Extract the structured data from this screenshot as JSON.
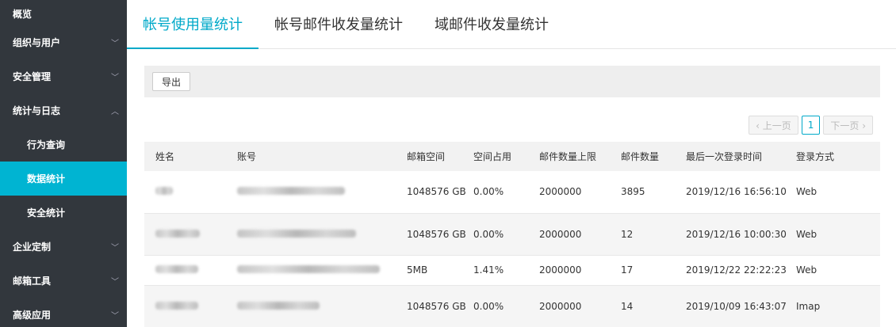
{
  "sidebar": {
    "items": [
      {
        "label": "概览",
        "chevron": ""
      },
      {
        "label": "组织与用户",
        "chevron": "﹀"
      },
      {
        "label": "安全管理",
        "chevron": "﹀"
      },
      {
        "label": "统计与日志",
        "chevron": "︿"
      },
      {
        "label": "行为查询",
        "chevron": ""
      },
      {
        "label": "数据统计",
        "chevron": ""
      },
      {
        "label": "安全统计",
        "chevron": ""
      },
      {
        "label": "企业定制",
        "chevron": "﹀"
      },
      {
        "label": "邮箱工具",
        "chevron": "﹀"
      },
      {
        "label": "高级应用",
        "chevron": "﹀"
      }
    ]
  },
  "tabs": [
    {
      "label": "帐号使用量统计"
    },
    {
      "label": "帐号邮件收发量统计"
    },
    {
      "label": "域邮件收发量统计"
    }
  ],
  "toolbar": {
    "export_label": "导出"
  },
  "pager": {
    "prev": "‹ 上一页",
    "page": "1",
    "next": "下一页 ›"
  },
  "table": {
    "headers": [
      "姓名",
      "账号",
      "邮箱空间",
      "空间占用",
      "邮件数量上限",
      "邮件数量",
      "最后一次登录时间",
      "登录方式"
    ],
    "rows": [
      {
        "space": "1048576 GB",
        "usage": "0.00%",
        "limit": "2000000",
        "count": "3895",
        "last_login": "2019/12/16 16:56:10",
        "method": "Web"
      },
      {
        "space": "1048576 GB",
        "usage": "0.00%",
        "limit": "2000000",
        "count": "12",
        "last_login": "2019/12/16 10:00:30",
        "method": "Web"
      },
      {
        "space": "5MB",
        "usage": "1.41%",
        "limit": "2000000",
        "count": "17",
        "last_login": "2019/12/22 22:22:23",
        "method": "Web"
      },
      {
        "space": "1048576 GB",
        "usage": "0.00%",
        "limit": "2000000",
        "count": "14",
        "last_login": "2019/10/09 16:43:07",
        "method": "Imap"
      }
    ]
  },
  "colors": {
    "accent": "#00b4d2",
    "sidebar_bg": "#32373d"
  }
}
